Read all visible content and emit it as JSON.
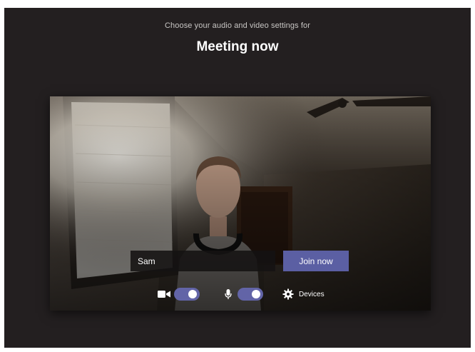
{
  "header": {
    "subtitle": "Choose your audio and video settings for",
    "title": "Meeting now"
  },
  "join": {
    "name_value": "Sam",
    "join_label": "Join now"
  },
  "controls": {
    "camera_on": true,
    "microphone_on": true,
    "devices_label": "Devices"
  },
  "icons": [
    "video-camera-icon",
    "microphone-icon",
    "gear-icon"
  ],
  "colors": {
    "background": "#231f20",
    "accent": "#6264a7",
    "join_button": "#5b5fa3",
    "text": "#ffffff",
    "muted_text": "#c8c6c4"
  }
}
